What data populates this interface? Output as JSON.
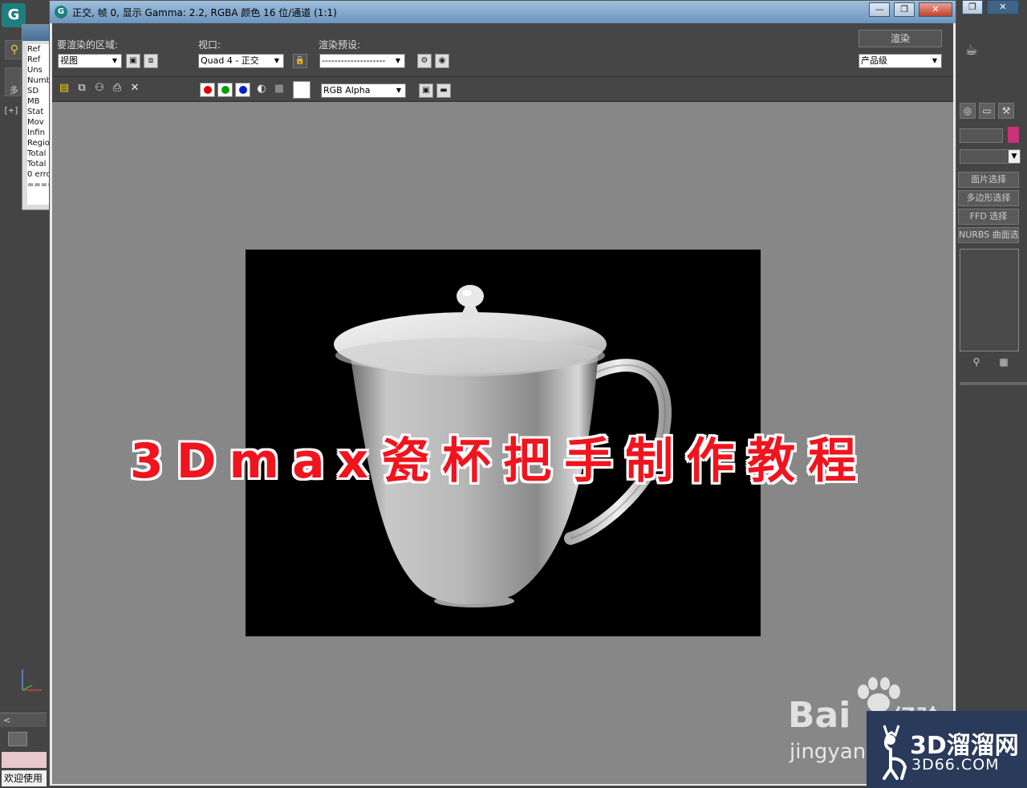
{
  "render_window": {
    "title": "正交, 帧 0, 显示 Gamma: 2.2, RGBA 颜色 16 位/通道 (1:1)",
    "area_label": "要渲染的区域:",
    "area_value": "视图",
    "viewport_label": "视口:",
    "viewport_value": "Quad 4 - 正交",
    "preset_label": "渲染预设:",
    "preset_value": "--------------------",
    "render_button": "渲染",
    "quality_value": "产品级",
    "channel_value": "RGB Alpha"
  },
  "background_app": {
    "plus_label": "[+]",
    "left_stub": "多",
    "scroll_label": "<",
    "welcome": "欢迎使用",
    "script_lines": [
      "Ref",
      "Ref",
      "Uns",
      "Numb",
      "SD",
      "MB",
      "Stat",
      "Mov",
      "Infin",
      "Regio",
      "Total",
      "Total",
      "0 erro",
      "===="
    ],
    "rp_buttons": [
      "面片选择",
      "多边形选择",
      "FFD 选择",
      "NURBS 曲面选择"
    ],
    "accent_color": "#c9317a"
  },
  "overlay": {
    "caption": "3Dmax瓷杯把手制作教程",
    "baidu_logo": "Bai",
    "baidu_trail": "经验",
    "baidu_sub": "jingyan.",
    "d66_title": "3D溜溜网",
    "d66_sub": "3D66.COM"
  },
  "colors": {
    "caption_red": "#f0141e",
    "render_bg": "#000000",
    "canvas_gray": "#878787"
  }
}
